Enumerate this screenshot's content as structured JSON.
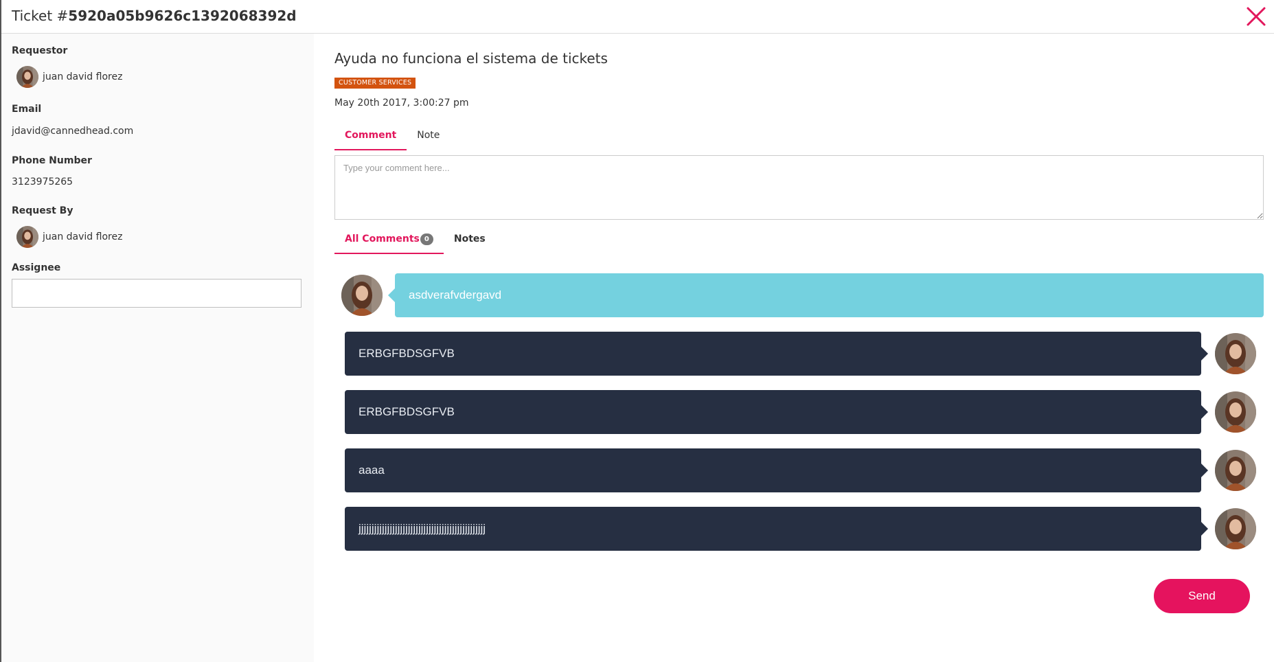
{
  "header": {
    "title_prefix": "Ticket #",
    "ticket_id": "5920a05b9626c1392068392d",
    "close_icon": "close-icon",
    "accent_color": "#e2175c"
  },
  "sidebar": {
    "requestor_label": "Requestor",
    "requestor_name": "juan david florez",
    "email_label": "Email",
    "email_value": "jdavid@cannedhead.com",
    "phone_label": "Phone Number",
    "phone_value": "3123975265",
    "request_by_label": "Request By",
    "request_by_name": "juan david florez",
    "assignee_label": "Assignee",
    "assignee_value": ""
  },
  "ticket": {
    "subject": "Ayuda no funciona el sistema de tickets",
    "category_badge": "CUSTOMER SERVICES",
    "date": "May 20th 2017, 3:00:27 pm"
  },
  "compose_tabs": [
    {
      "label": "Comment",
      "active": true
    },
    {
      "label": "Note",
      "active": false
    }
  ],
  "compose": {
    "placeholder": "Type your comment here...",
    "value": ""
  },
  "thread_tabs": {
    "all_comments_label": "All Comments",
    "all_comments_count": "0",
    "notes_label": "Notes"
  },
  "messages": [
    {
      "text": "asdverafvdergavd",
      "direction": "incoming",
      "color": "#74d1df"
    },
    {
      "text": "ERBGFBDSGFVB",
      "direction": "outgoing",
      "color": "#262f42"
    },
    {
      "text": "ERBGFBDSGFVB",
      "direction": "outgoing",
      "color": "#262f42"
    },
    {
      "text": "aaaa",
      "direction": "outgoing",
      "color": "#262f42"
    },
    {
      "text": "jjjjjjjjjjjjjjjjjjjjjjjjjjjjjjjjjjjjjjjjjjjjjjjjj",
      "direction": "outgoing",
      "color": "#262f42"
    }
  ],
  "send_button": {
    "label": "Send",
    "color": "#e5135e"
  }
}
